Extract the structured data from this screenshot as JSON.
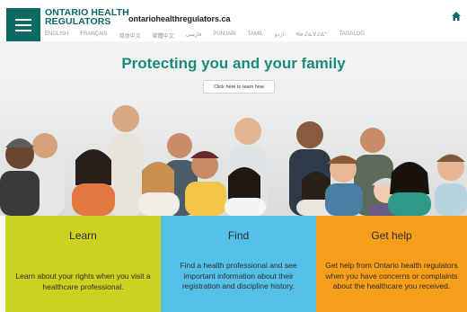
{
  "header": {
    "brand_line1": "ONTARIO HEALTH",
    "brand_line2": "REGULATORS",
    "domain": "ontariohealthregulators.ca",
    "languages": [
      "ENGLISH",
      "FRANÇAIS",
      "简体中文",
      "繁體中文",
      "فارسی",
      "PUNJABI",
      "TAMIL",
      "اردو",
      "ᐊᓂᔑᓈᐯᒧᐎᓐ",
      "TAGALOG"
    ]
  },
  "hero": {
    "title": "Protecting you and your family",
    "cta_label": "Click here to learn how"
  },
  "panels": [
    {
      "title": "Learn",
      "text": "Learn about your rights when you visit a healthcare professional."
    },
    {
      "title": "Find",
      "text": "Find a health professional and see important information about their registration and discipline history."
    },
    {
      "title": "Get help",
      "text": "Get help from Ontario health regulators when you have concerns or complaints about the healthcare you received."
    }
  ],
  "colors": {
    "brand": "#0d6a63",
    "title": "#1c8a7d",
    "learn": "#cbd320",
    "find": "#55c1e8",
    "help": "#f79e1b"
  }
}
